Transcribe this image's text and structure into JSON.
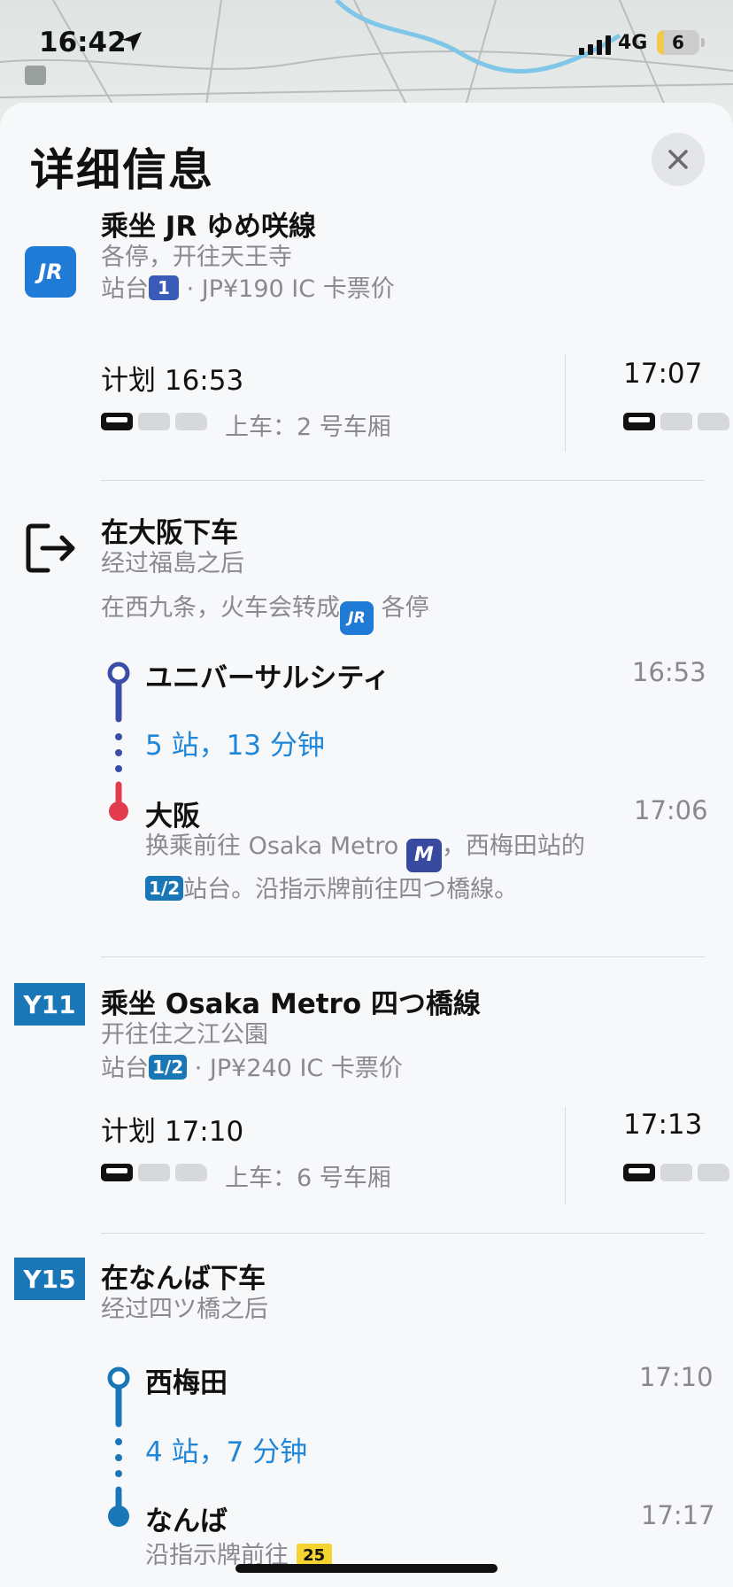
{
  "status": {
    "time": "16:42",
    "network": "4G",
    "battery": "6"
  },
  "header": {
    "title": "详细信息",
    "close_icon": "close-icon"
  },
  "leg1": {
    "logo": "JR",
    "title": "乘坐 JR ゆめ咲線",
    "subtitle": "各停，开往天王寺",
    "platform_label": "站台",
    "platform": "1",
    "fare": "· JP¥190 IC 卡票价",
    "dep_time": "计划 16:53",
    "boarding": "上车：2 号车厢",
    "next_time": "17:07"
  },
  "alight1": {
    "title": "在大阪下车",
    "subtitle": "经过福島之后",
    "note_prefix": "在西九条，火车会转成",
    "note_logo": "JR",
    "note_suffix": "各停",
    "stops": [
      {
        "name": "ユニバーサルシティ",
        "time": "16:53"
      },
      {
        "name": "大阪",
        "time": "17:06"
      }
    ],
    "summary": "5 站，13 分钟",
    "transfer_prefix": "换乘前往 Osaka Metro",
    "transfer_logo": "M",
    "transfer_middle": "，西梅田站的",
    "transfer_platform": "1/2",
    "transfer_suffix": "站台。沿指示牌前往四つ橋線。"
  },
  "leg2": {
    "badge": "Y11",
    "title": "乘坐 Osaka Metro 四つ橋線",
    "subtitle": "开往住之江公園",
    "platform_label": "站台",
    "platform": "1/2",
    "fare": "· JP¥240 IC 卡票价",
    "dep_time": "计划 17:10",
    "boarding": "上车：6 号车厢",
    "next_time": "17:13"
  },
  "alight2": {
    "badge": "Y15",
    "title": "在なんば下车",
    "subtitle": "经过四ツ橋之后",
    "stops": [
      {
        "name": "西梅田",
        "time": "17:10"
      },
      {
        "name": "なんば",
        "time": "17:17"
      }
    ],
    "summary": "4 站，7 分钟",
    "note_prefix": "沿指示牌前往",
    "note_badge": "25"
  },
  "colors": {
    "jr_blue": "#1f7bd6",
    "metro_navy": "#3a4ea8",
    "yotsubashi_blue": "#1977b8",
    "arrival_red": "#e23b4e",
    "link_blue": "#1f86d8"
  }
}
